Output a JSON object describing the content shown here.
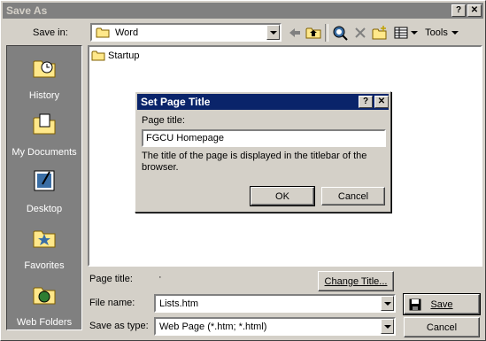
{
  "window": {
    "title": "Save As",
    "help_btn": "?",
    "close_btn": "✕"
  },
  "save_in": {
    "label": "Save in:",
    "value": "Word"
  },
  "toolbar": {
    "tools_label": "Tools"
  },
  "places": [
    {
      "label": "History"
    },
    {
      "label": "My Documents"
    },
    {
      "label": "Desktop"
    },
    {
      "label": "Favorites"
    },
    {
      "label": "Web Folders"
    }
  ],
  "files": [
    {
      "name": "Startup"
    }
  ],
  "page_title": {
    "label": "Page title:",
    "value": "·",
    "change_button": "Change Title..."
  },
  "file_name": {
    "label": "File name:",
    "value": "Lists.htm"
  },
  "save_as_type": {
    "label": "Save as type:",
    "value": "Web Page (*.htm; *.html)"
  },
  "buttons": {
    "save": "Save",
    "cancel": "Cancel"
  },
  "dialog": {
    "title": "Set Page Title",
    "help_btn": "?",
    "close_btn": "✕",
    "field_label": "Page title:",
    "field_value": "FGCU Homepage",
    "description": "The title of the page is displayed in the titlebar of the browser.",
    "ok": "OK",
    "cancel": "Cancel"
  },
  "colors": {
    "titlebar_inactive": "#808080",
    "titlebar_active": "#0a246a",
    "face": "#d4d0c8"
  }
}
